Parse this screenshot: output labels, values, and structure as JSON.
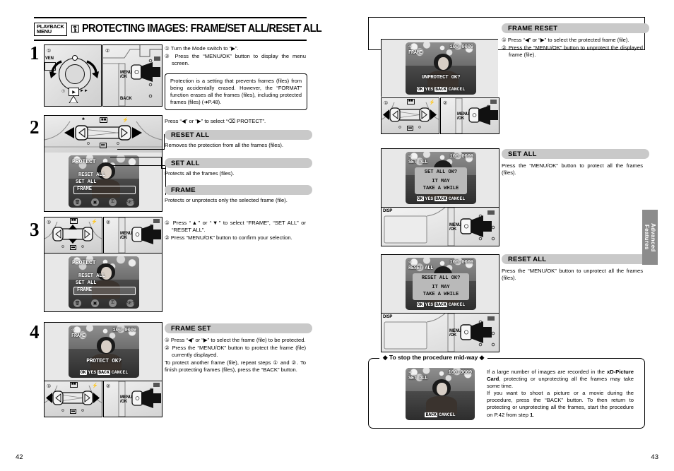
{
  "header": {
    "tag": "PLAYBACK MENU",
    "key_icon": "protect-key-icon",
    "title": "PROTECTING IMAGES: FRAME/SET ALL/RESET ALL"
  },
  "page_numbers": {
    "left": "42",
    "right": "43"
  },
  "side_tab": {
    "label": "Advanced Features"
  },
  "left": {
    "steps": [
      "1",
      "2",
      "3",
      "4"
    ],
    "step1": {
      "markers": [
        "①",
        "②"
      ],
      "instructions": [
        "① Turn the Mode switch to “▶”.",
        "② Press the “MENU/OK” button to display the menu screen."
      ],
      "note": "Protection is a setting that prevents frames (files) from being accidentally erased. However, the “FORMAT” function erases all the frames (files), including protected frames (files) (➜P.48).",
      "labels": {
        "menu_ok": "MENU\n/OK",
        "back": "BACK"
      }
    },
    "step2": {
      "instruction": "Press “◀” or “▶” to select “⌫ PROTECT”.",
      "lcd": {
        "title": "PROTECT",
        "items": [
          "RESET ALL",
          "SET ALL",
          "FRAME"
        ],
        "selected": "FRAME"
      },
      "sections": [
        {
          "bar": "RESET ALL",
          "text": "Removes the protection from all the frames (files)."
        },
        {
          "bar": "SET ALL",
          "text": "Protects all the frames (files)."
        },
        {
          "bar": "FRAME",
          "text": "Protects or unprotects only the selected frame (file)."
        }
      ]
    },
    "step3": {
      "markers": [
        "①",
        "②"
      ],
      "instructions": [
        "① Press “▲” or “▼” to select “FRAME”, “SET ALL” or “RESET ALL”.",
        "② Press “MENU/OK” button to confirm your selection."
      ],
      "lcd": {
        "title": "PROTECT",
        "items": [
          "RESET ALL",
          "SET ALL",
          "FRAME"
        ],
        "selected": "FRAME"
      },
      "labels": {
        "menu_ok": "MENU\n/OK"
      }
    },
    "step4": {
      "markers": [
        "①",
        "②"
      ],
      "bar": "FRAME SET",
      "instructions": [
        "① Press “◀” or “▶” to select the frame (file) to be protected.",
        "② Press the “MENU/OK” button to protect the frame (file) currently displayed."
      ],
      "extra": "To protect another frame (file), repeat steps ① and ②. To finish protecting frames (files), press the “BACK” button.",
      "lcd": {
        "badge": "⌫",
        "mode": "FRAME",
        "counter": "100-0009",
        "prompt": "PROTECT OK?",
        "ok_key": "OK",
        "ok_label": "YES",
        "back_key": "BACK",
        "back_label": "CANCEL"
      },
      "labels": {
        "menu_ok": "MENU\n/OK"
      }
    }
  },
  "right": {
    "frame_reset": {
      "bar": "FRAME RESET",
      "instructions": [
        "① Press “◀” or “▶” to select the protected frame (file).",
        "② Press the “MENU/OK” button to unprotect the displayed frame (file)."
      ],
      "lcd": {
        "badge": "⌫",
        "mode": "FRAME",
        "counter": "100-0009",
        "prompt": "UNPROTECT OK?",
        "ok_key": "OK",
        "ok_label": "YES",
        "back_key": "BACK",
        "back_label": "CANCEL"
      },
      "labels": {
        "menu_ok": "MENU\n/OK"
      }
    },
    "set_all": {
      "bar": "SET ALL",
      "text": "Press the “MENU/OK” button to protect all the frames (files).",
      "lcd": {
        "badge": "⌫",
        "mode": "SET ALL",
        "counter": "100-0009",
        "dialog_line1": "SET ALL OK?",
        "dialog_line2": "IT MAY",
        "dialog_line3": "TAKE A WHILE",
        "ok_key": "OK",
        "ok_label": "YES",
        "back_key": "BACK",
        "back_label": "CANCEL"
      },
      "labels": {
        "disp": "DISP",
        "menu_ok": "MENU\n/OK"
      }
    },
    "reset_all": {
      "bar": "RESET ALL",
      "text": "Press the “MENU/OK” button to unprotect all the frames (files).",
      "lcd": {
        "badge": "⌫",
        "mode": "RESET ALL",
        "counter": "100-0009",
        "dialog_line1": "RESET ALL OK?",
        "dialog_line2": "IT MAY",
        "dialog_line3": "TAKE A WHILE",
        "ok_key": "OK",
        "ok_label": "YES",
        "back_key": "BACK",
        "back_label": "CANCEL"
      },
      "labels": {
        "disp": "DISP",
        "menu_ok": "MENU\n/OK"
      }
    },
    "tip": {
      "title": "To stop the procedure mid-way",
      "text_1": "If a large number of images are recorded in the ",
      "text_bold": "xD-Picture Card",
      "text_2": ", protecting or unprotecting all the frames may take some time.",
      "text_3": "If you want to shoot a picture or a movie during the procedure, press the “BACK” button. To then return to protecting or unprotecting all the frames, start the procedure on P.42 from step ",
      "text_bold2": "1",
      "text_4": ".",
      "lcd": {
        "badge": "⌫",
        "mode": "SET ALL",
        "counter": "100-0009",
        "back_key": "BACK",
        "back_label": "CANCEL"
      }
    }
  }
}
